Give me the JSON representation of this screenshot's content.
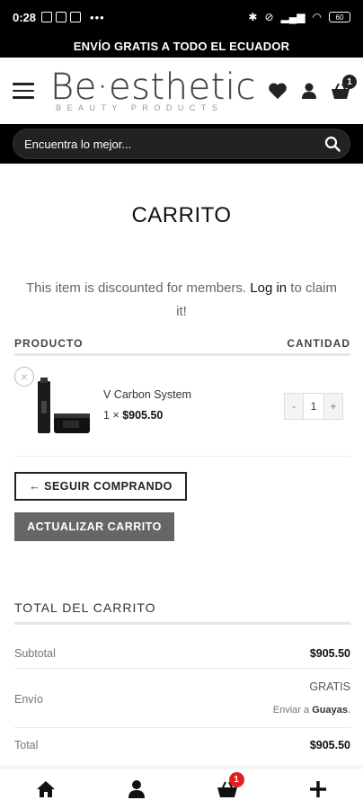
{
  "status_bar": {
    "time": "0:28",
    "battery": "60",
    "dots": "•••"
  },
  "promo": {
    "text": "ENVÍO GRATIS A TODO EL ECUADOR"
  },
  "header": {
    "logo_brand": "Be·esthetic",
    "logo_tagline": "BEAUTY PRODUCTS",
    "cart_count": "1"
  },
  "search": {
    "placeholder": "Encuentra lo mejor..."
  },
  "page": {
    "title": "CARRITO",
    "member_msg_before": "This item is discounted for members. ",
    "member_msg_login": "Log in",
    "member_msg_after": " to claim it!"
  },
  "table": {
    "col_product": "PRODUCTO",
    "col_quantity": "CANTIDAD"
  },
  "items": [
    {
      "name": "V Carbon System",
      "qty_prefix": "1 × ",
      "price": "$905.50",
      "quantity": "1",
      "minus": "-",
      "plus": "+",
      "remove": "×"
    }
  ],
  "buttons": {
    "continue": "← SEGUIR COMPRANDO",
    "update": "ACTUALIZAR CARRITO"
  },
  "totals": {
    "title": "TOTAL DEL CARRITO",
    "subtotal_label": "Subtotal",
    "subtotal_value": "$905.50",
    "shipping_label": "Envío",
    "shipping_value": "GRATIS",
    "shipping_dest_prefix": "Enviar a ",
    "shipping_dest": "Guayas",
    "shipping_dest_suffix": ".",
    "total_label": "Total",
    "total_value": "$905.50"
  },
  "bottom_nav": {
    "cart_badge": "1"
  },
  "colors": {
    "black": "#000000",
    "badge_red": "#e02020",
    "update_button": "#666666"
  }
}
